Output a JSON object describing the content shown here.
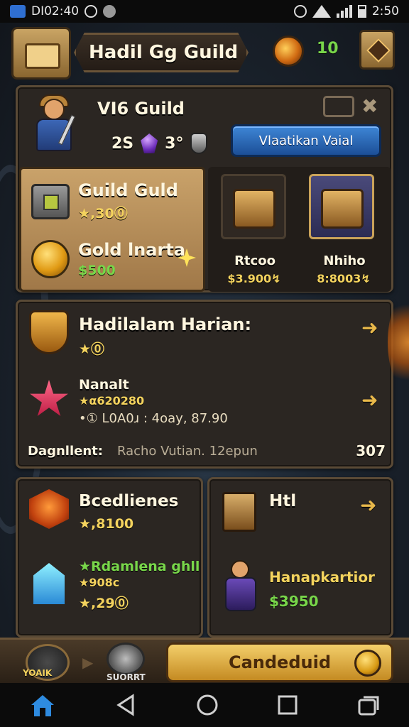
{
  "status_bar": {
    "time_left": "DI02:40",
    "time_right": "2:50"
  },
  "top_bar": {
    "title": "Hadil Gg Guild",
    "currency_count": "10"
  },
  "guild_panel": {
    "title": "VI6 Guild",
    "stat_a": "2S",
    "stat_b": "3°",
    "action_button": "Vlaatikan Vaial"
  },
  "items_left": [
    {
      "name": "Guild Guld",
      "value": "★,30⓪"
    },
    {
      "name": "Gold lnarta",
      "value": "$500"
    }
  ],
  "slots": [
    {
      "label": "Rtcoo",
      "price": "$3.900↯"
    },
    {
      "label": "Nhiho",
      "price": "8:8003↯"
    }
  ],
  "harian_panel": {
    "title": "Hadilalam Harian:",
    "title_value": "★⓪",
    "task_name": "Nanalt",
    "task_code": "★α620280",
    "task_stats": "•① L0A0ɹ : 4oay, 87.90",
    "footer_label": "Dagnllent:",
    "footer_text": "Racho Vutian. 12epun",
    "footer_count": "307"
  },
  "bottom_left": {
    "title": "Bcedlienes",
    "title_value": "★,8100",
    "item_name": "★Rdamlena ghll",
    "item_value_a": "★908c",
    "item_value_b": "★,29⓪"
  },
  "bottom_right": {
    "title": "Htl",
    "item_name": "Hanapkartior",
    "item_value": "$3950"
  },
  "action_bar": {
    "left_label": "YOAIK",
    "sort_label": "SUORRT",
    "main_button": "Candeduid"
  },
  "colors": {
    "panel_bg": "#2b2622",
    "gold_text": "#f4d35e",
    "green_text": "#78d64a",
    "blue_button": "#2e6fc0",
    "action_button": "#e2b84a"
  }
}
